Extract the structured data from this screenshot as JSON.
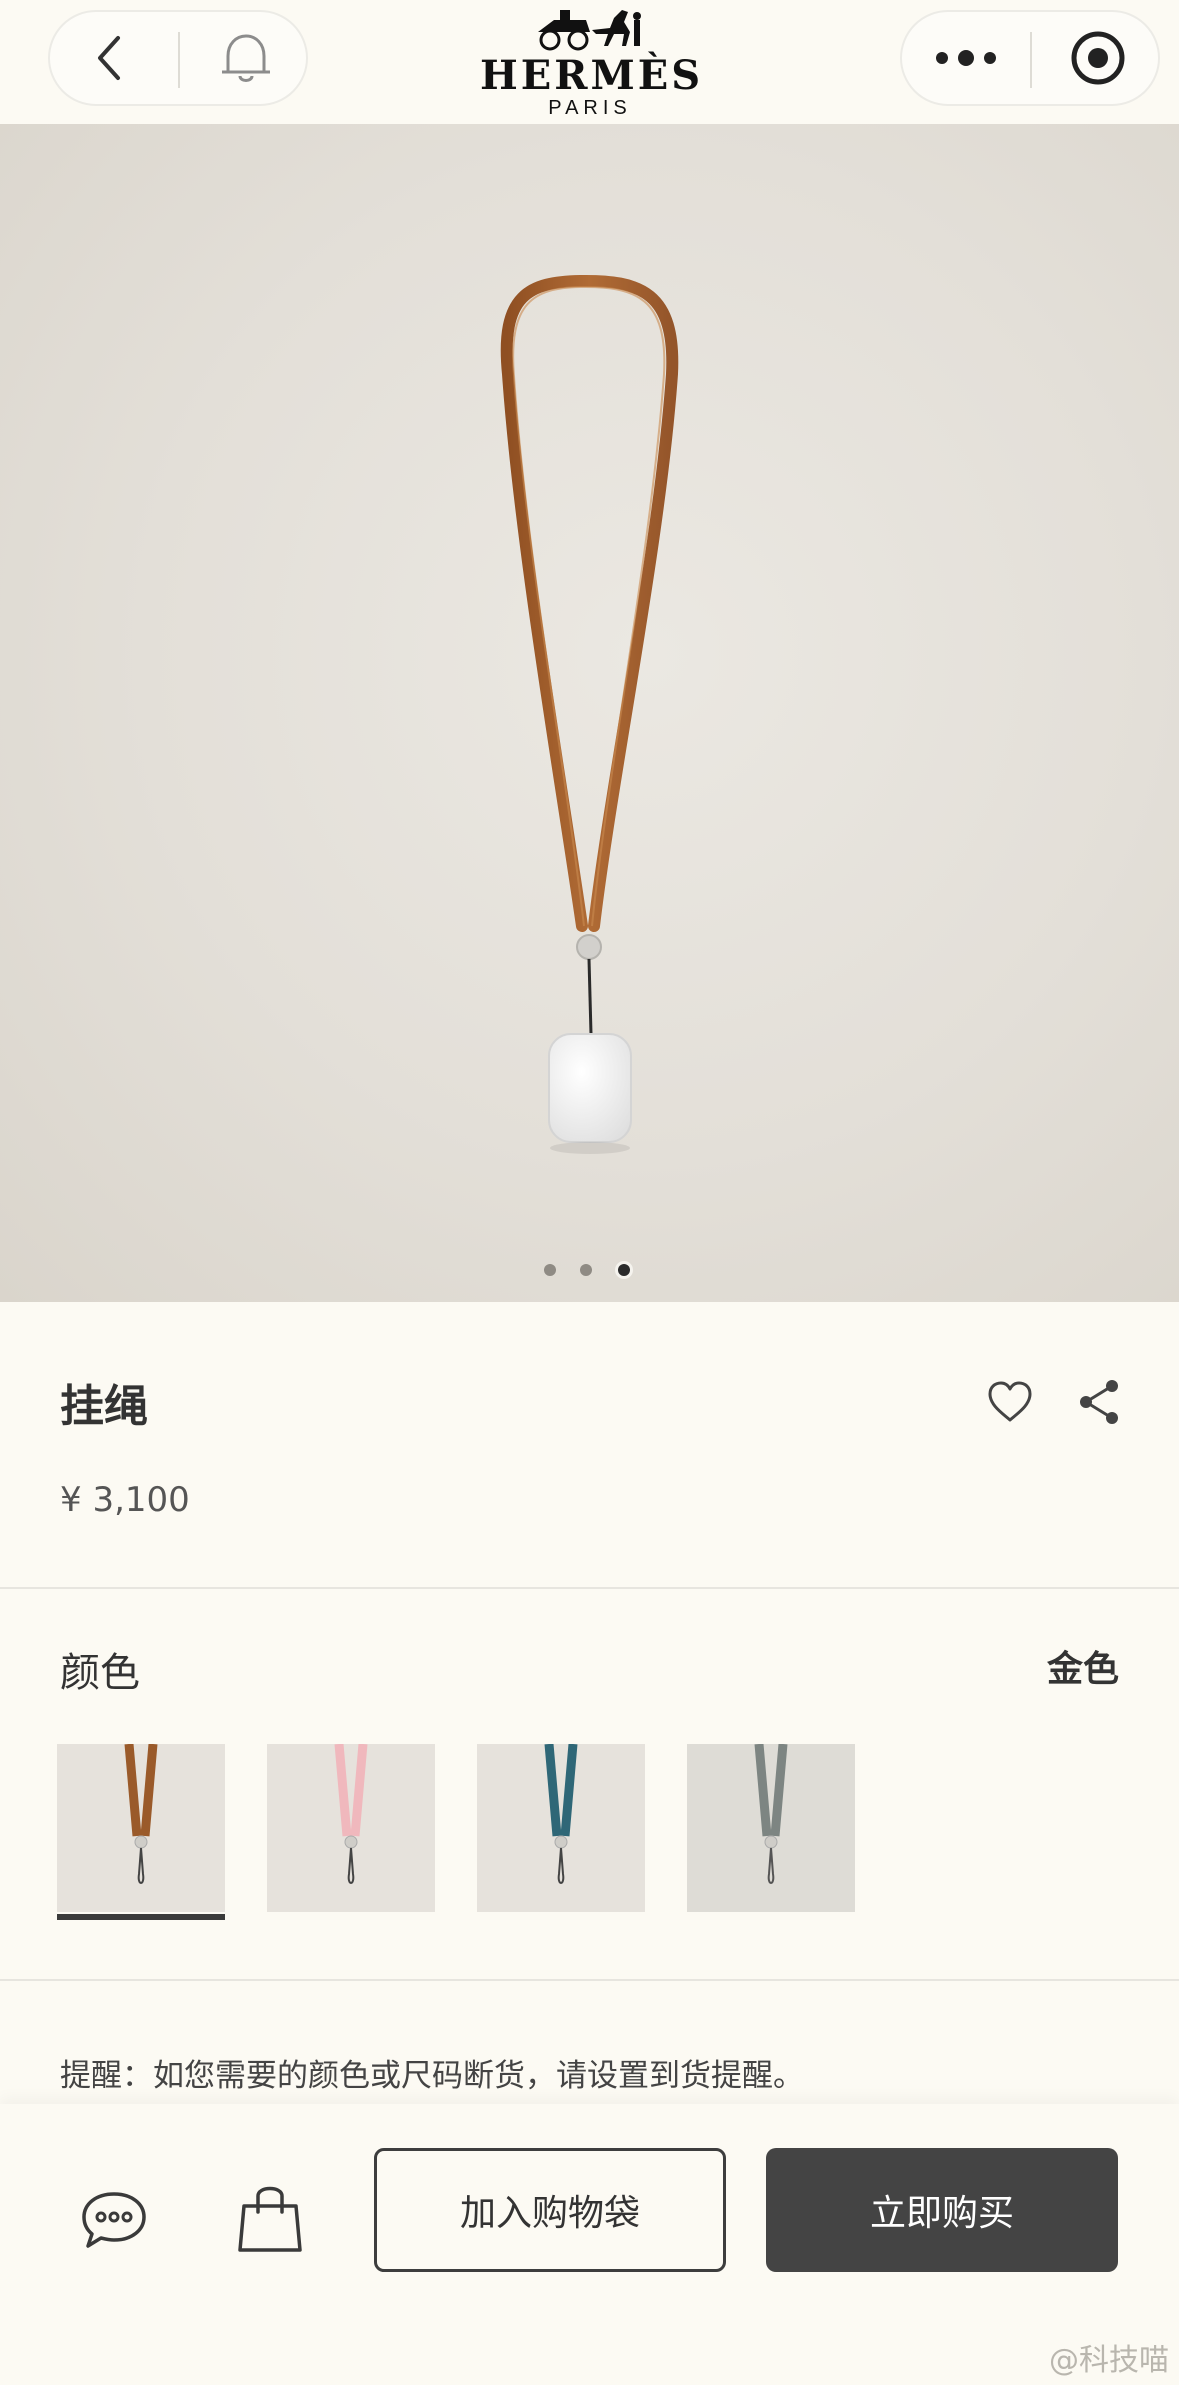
{
  "header": {
    "brand": "HERMÈS",
    "city": "PARIS",
    "back_icon": "chevron-left-icon",
    "bell_icon": "bell-icon",
    "more_icon": "more-dots-icon",
    "target_icon": "record-target-icon"
  },
  "gallery": {
    "pages": 3,
    "active_index": 2
  },
  "product": {
    "title": "挂绳",
    "price": "¥ 3,100",
    "favorite_icon": "heart-icon",
    "share_icon": "share-icon"
  },
  "color": {
    "label": "颜色",
    "selected": "金色",
    "swatches": [
      {
        "strap_color": "#9a5a2a",
        "selected": true
      },
      {
        "strap_color": "#f0b8bd",
        "selected": false
      },
      {
        "strap_color": "#2f6777",
        "selected": false
      },
      {
        "strap_color": "#7d8582",
        "selected": false
      }
    ]
  },
  "reminder": "提醒：如您需要的颜色或尺码断货，请设置到货提醒。",
  "bottom_bar": {
    "chat_icon": "chat-bubble-icon",
    "bag_icon": "shopping-bag-icon",
    "add_to_bag": "加入购物袋",
    "buy_now": "立即购买"
  },
  "watermark": "@科技喵"
}
